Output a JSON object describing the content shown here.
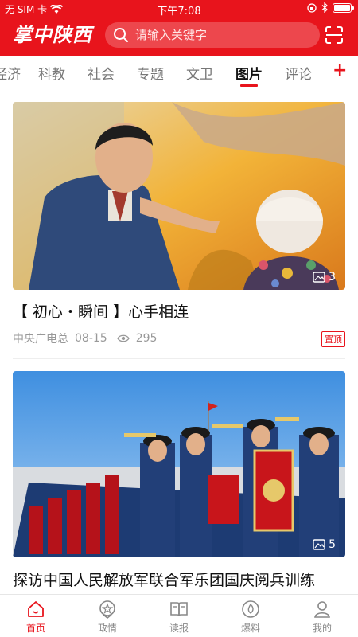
{
  "status_bar": {
    "carrier": "无 SIM 卡",
    "time": "下午7:08",
    "battery_level": 0.9
  },
  "header": {
    "logo": "掌中陕西",
    "search_placeholder": "请输入关键字",
    "scan_icon": "scan-icon"
  },
  "tabs": {
    "items": [
      "经济",
      "科教",
      "社会",
      "专题",
      "文卫",
      "图片",
      "评论"
    ],
    "active": "图片",
    "add_label": "+"
  },
  "articles": [
    {
      "title": "【 初心・瞬间 】心手相连",
      "source": "中央广电总",
      "date": "08-15",
      "views": "295",
      "badge": "置顶",
      "image_count": "3"
    },
    {
      "title": "探访中国人民解放军联合军乐团国庆阅兵训练",
      "image_count": "5",
      "banner_text": "中国人民解放军联合军乐团"
    }
  ],
  "bottom_nav": {
    "items": [
      {
        "label": "首页",
        "icon": "home-icon"
      },
      {
        "label": "政情",
        "icon": "star-badge-icon"
      },
      {
        "label": "读报",
        "icon": "book-icon"
      },
      {
        "label": "爆料",
        "icon": "flame-icon"
      },
      {
        "label": "我的",
        "icon": "user-icon"
      }
    ],
    "active": "首页"
  },
  "colors": {
    "brand_red": "#e8141c",
    "text_dark": "#111111",
    "text_gray": "#999999"
  }
}
